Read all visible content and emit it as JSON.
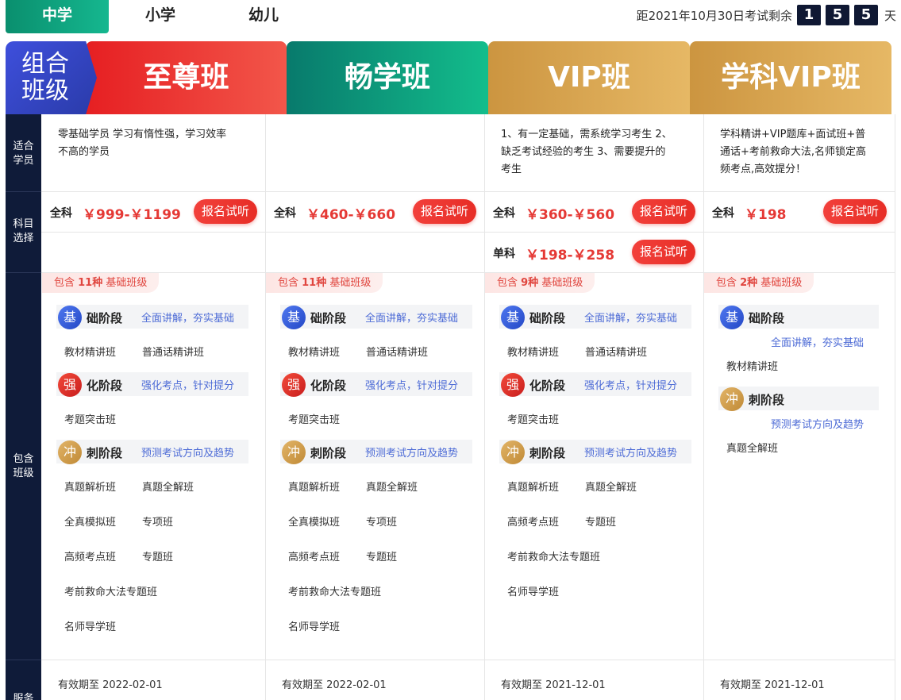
{
  "tabs": [
    "中学",
    "小学",
    "幼儿"
  ],
  "countdown": {
    "prefix": "距2021年10月30日考试剩余",
    "digits": [
      "1",
      "5",
      "5"
    ],
    "unit": "天"
  },
  "logo": {
    "line1": "组合",
    "line2": "班级"
  },
  "packages": [
    {
      "name": "至尊班"
    },
    {
      "name": "畅学班"
    },
    {
      "name": "VIP班"
    },
    {
      "name": "学科VIP班"
    }
  ],
  "side": {
    "fit": [
      "适合",
      "学员"
    ],
    "subject": [
      "科目",
      "选择"
    ],
    "include": [
      "包含",
      "班级"
    ],
    "service": [
      "服务"
    ]
  },
  "fit_text": [
    [
      "零基础学员 学习有惰性强，学习效率",
      "不高的学员"
    ],
    [],
    [
      "1、有一定基础，需系统学习考生 2、",
      "缺乏考试经验的考生 3、需要提升的",
      "考生"
    ],
    [
      "学科精讲+VIP题库+面试班+普",
      "通话+考前救命大法,名师锁定高",
      "频考点,高效提分！"
    ]
  ],
  "prices": [
    {
      "label": "全科",
      "value": "￥999-￥1199"
    },
    {
      "label": "全科",
      "value": "￥460-￥660"
    },
    {
      "label": "全科",
      "value": "￥360-￥560"
    },
    {
      "label": "全科",
      "value": "￥198"
    }
  ],
  "single_price": {
    "label": "单科",
    "value": "￥198-￥258"
  },
  "signup_label": "报名试听",
  "includes": [
    {
      "pre": "包含 ",
      "count": "11种",
      "post": " 基础班级"
    },
    {
      "pre": "包含 ",
      "count": "11种",
      "post": " 基础班级"
    },
    {
      "pre": "包含 ",
      "count": "9种",
      "post": " 基础班级"
    },
    {
      "pre": "包含 ",
      "count": "2种",
      "post": " 基础班级"
    }
  ],
  "stages": {
    "basic": {
      "badge": "基",
      "name": "础阶段",
      "desc": "全面讲解，夯实基础"
    },
    "strong": {
      "badge": "强",
      "name": "化阶段",
      "desc": "强化考点，针对提分"
    },
    "sprint": {
      "badge": "冲",
      "name": "刺阶段",
      "desc": "预测考试方向及趋势"
    }
  },
  "classes": {
    "col1": {
      "basic": [
        "教材精讲班",
        "普通话精讲班"
      ],
      "strong": [
        "考题突击班"
      ],
      "sprint": [
        "真题解析班",
        "真题全解班",
        "全真模拟班",
        "专项班",
        "高频考点班",
        "专题班",
        "考前救命大法专题班",
        "名师导学班"
      ]
    },
    "col2": {
      "basic": [
        "教材精讲班",
        "普通话精讲班"
      ],
      "strong": [
        "考题突击班"
      ],
      "sprint": [
        "真题解析班",
        "真题全解班",
        "全真模拟班",
        "专项班",
        "高频考点班",
        "专题班",
        "考前救命大法专题班",
        "名师导学班"
      ]
    },
    "col3": {
      "basic": [
        "教材精讲班",
        "普通话精讲班"
      ],
      "strong": [
        "考题突击班"
      ],
      "sprint": [
        "真题解析班",
        "真题全解班",
        "高频考点班",
        "专题班",
        "考前救命大法专题班",
        "名师导学班"
      ]
    },
    "col4": {
      "basic": [
        "教材精讲班"
      ],
      "sprint": [
        "真题全解班"
      ]
    }
  },
  "valid": [
    "有效期至 2022-02-01",
    "有效期至 2022-02-01",
    "有效期至 2021-12-01",
    "有效期至 2021-12-01"
  ],
  "colors": {
    "red": "#e53935",
    "green": "#0a8f6e",
    "gold": "#d4a04a",
    "navy": "#0f1b39",
    "blue": "#4d6bd6"
  }
}
